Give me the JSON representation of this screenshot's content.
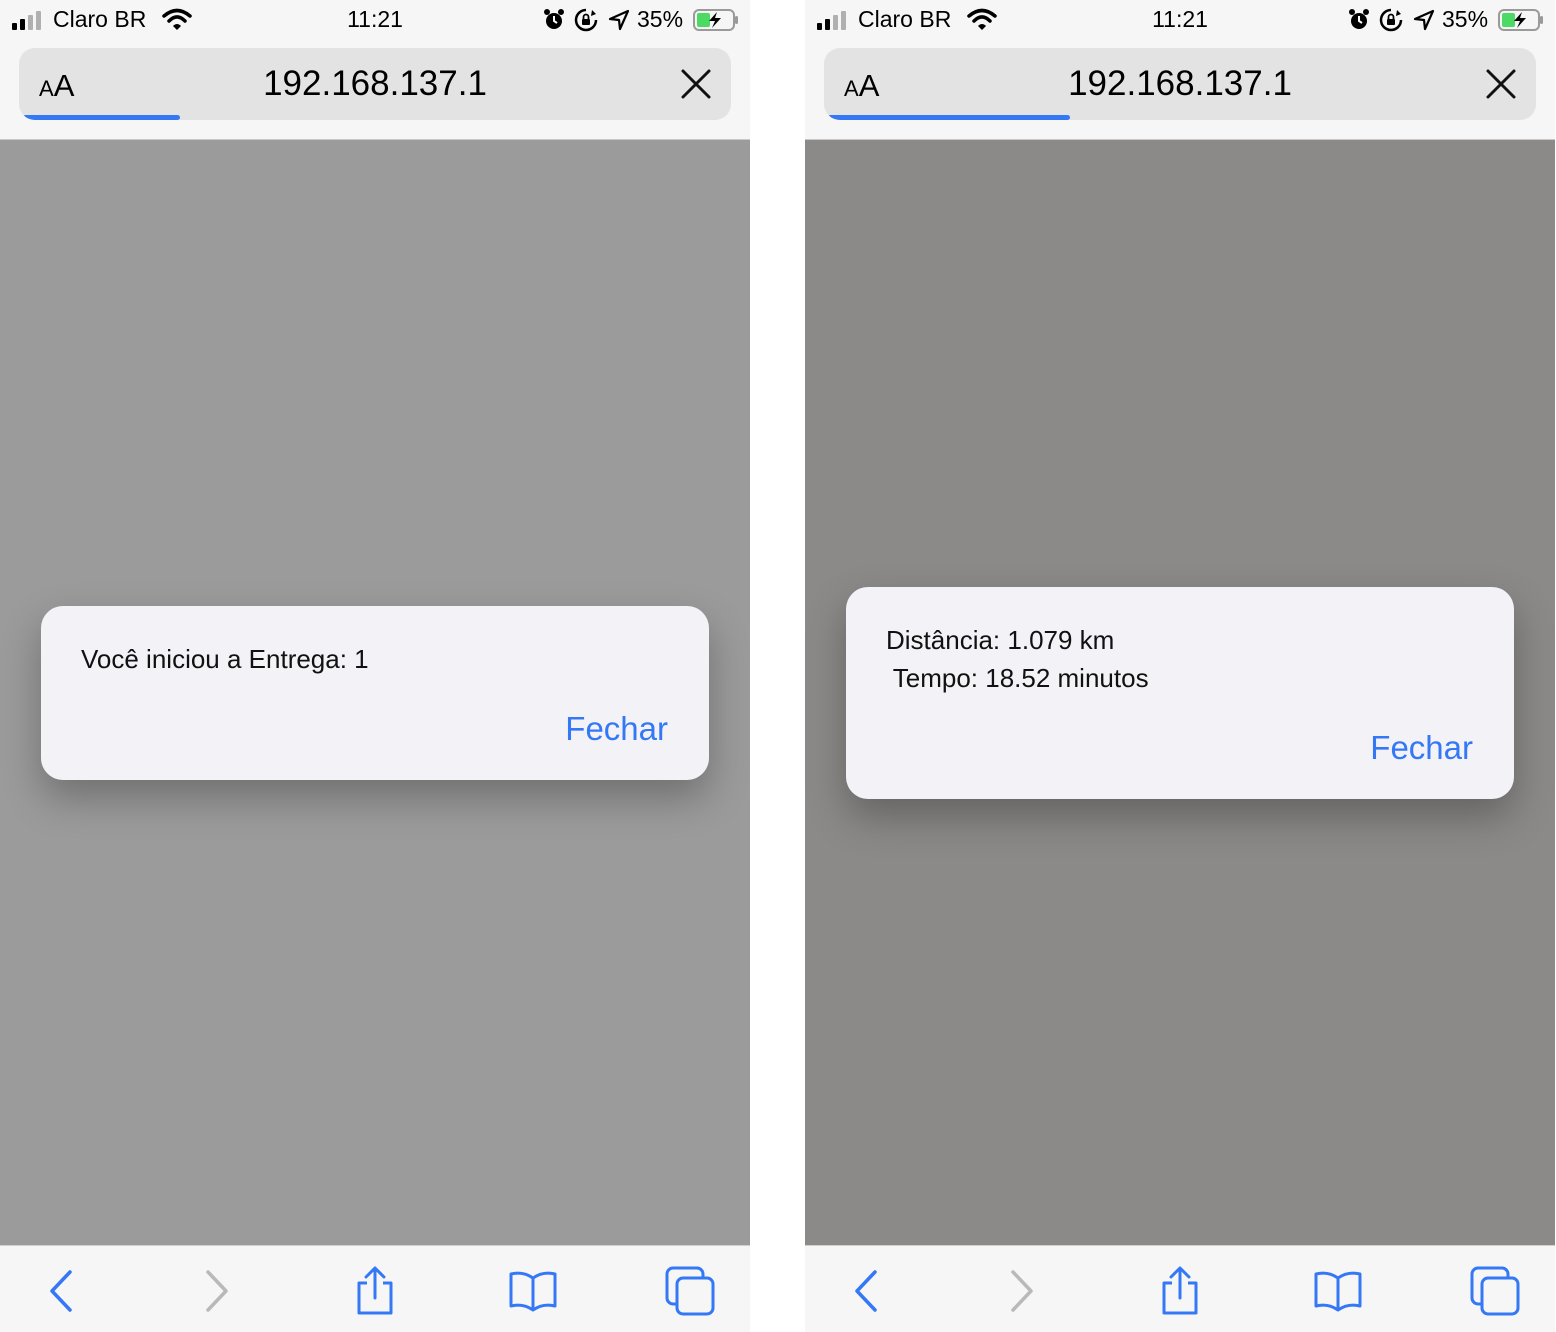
{
  "screens": [
    {
      "status": {
        "carrier": "Claro BR",
        "time": "11:21",
        "battery": "35%"
      },
      "browser": {
        "text_size_small": "A",
        "text_size_big": "A",
        "url": "192.168.137.1",
        "load_progress": 0.22
      },
      "dialog": {
        "message": "Você iniciou a Entrega: 1",
        "button": "Fechar"
      }
    },
    {
      "status": {
        "carrier": "Claro BR",
        "time": "11:21",
        "battery": "35%"
      },
      "browser": {
        "text_size_small": "A",
        "text_size_big": "A",
        "url": "192.168.137.1",
        "load_progress": 0.34
      },
      "dialog": {
        "message": "Distância: 1.079 km\n Tempo: 18.52 minutos",
        "button": "Fechar"
      }
    }
  ],
  "colors": {
    "accent": "#3478f6",
    "disabled": "#b9b9b9",
    "overlay_left": "#9b9b9b",
    "overlay_right": "#8b8a88",
    "battery_fill": "#4cd964"
  },
  "icons": [
    "signal-icon",
    "wifi-icon",
    "alarm-icon",
    "rotation-lock-icon",
    "location-arrow-icon",
    "battery-charging-icon",
    "close-icon",
    "back-icon",
    "forward-icon",
    "share-icon",
    "bookmarks-icon",
    "tabs-icon"
  ]
}
